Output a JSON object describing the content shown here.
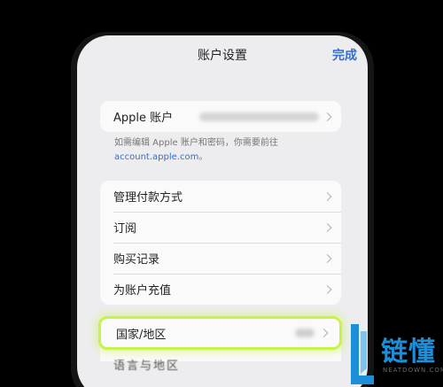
{
  "nav": {
    "title": "账户设置",
    "done": "完成"
  },
  "account_group": {
    "label": "Apple 账户"
  },
  "footnote": {
    "text": "如需编辑 Apple 账户和密码，你需要前往",
    "link": "account.apple.com",
    "suffix": "。"
  },
  "menu_group": [
    {
      "label": "管理付款方式"
    },
    {
      "label": "订阅"
    },
    {
      "label": "购买记录"
    },
    {
      "label": "为账户充值"
    }
  ],
  "region_row": {
    "label": "国家/地区"
  },
  "partial_row": {
    "label": "语言与地区"
  },
  "watermark": {
    "brand": "链懂",
    "domain": "NEATDOWN.COM"
  },
  "colors": {
    "accent": "#2f6fd6",
    "highlight": "#c9f24a",
    "watermark": "#1d8fd8"
  }
}
